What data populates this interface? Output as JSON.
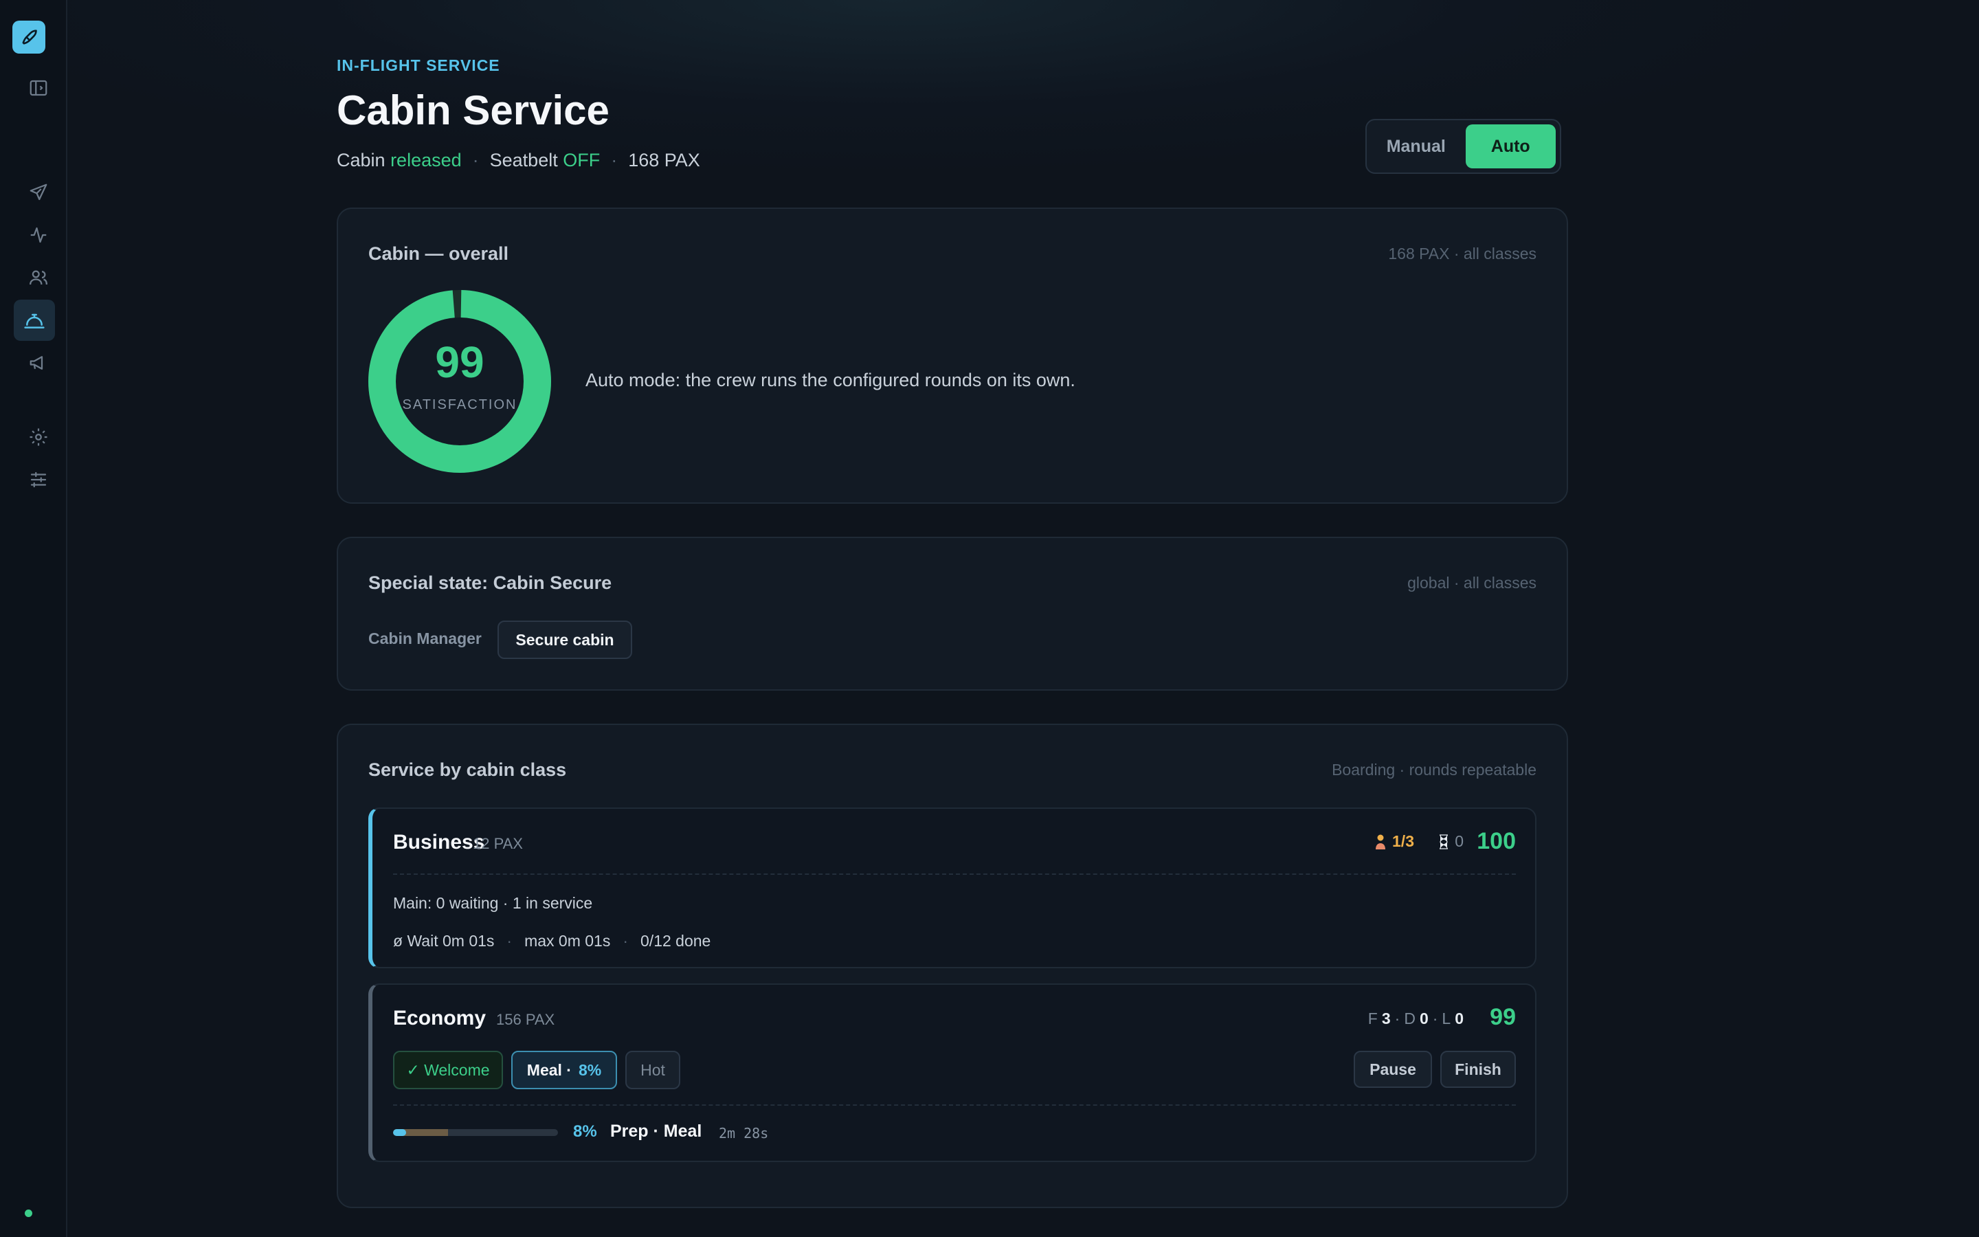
{
  "header": {
    "eyebrow": "IN-FLIGHT SERVICE",
    "title": "Cabin Service",
    "status": {
      "cabin_prefix": "Cabin",
      "cabin_state": "released",
      "seatbelt_prefix": "Seatbelt",
      "seatbelt_state": "OFF",
      "pax": "168 PAX"
    },
    "mode": {
      "manual_label": "Manual",
      "auto_label": "Auto",
      "selected": "Auto"
    }
  },
  "overall": {
    "title": "Cabin — overall",
    "meta": "168 PAX · all classes",
    "satisfaction": "99",
    "satisfaction_value": 99,
    "satisfaction_label": "SATISFACTION",
    "message": "Auto mode: the crew runs the configured rounds on its own."
  },
  "special": {
    "title": "Special state: Cabin Secure",
    "meta": "global · all classes",
    "role_label": "Cabin Manager",
    "button_label": "Secure cabin"
  },
  "service": {
    "title": "Service by cabin class",
    "meta": "Boarding · rounds repeatable",
    "business": {
      "name": "Business",
      "pax": "12 PAX",
      "crew": "1/3",
      "queue": "0",
      "score": "100",
      "main_line": "Main: 0 waiting · 1 in service",
      "wait": "ø Wait 0m 01s",
      "max": "max 0m 01s",
      "done": "0/12 done"
    },
    "economy": {
      "name": "Economy",
      "pax": "156 PAX",
      "f_label": "F",
      "f_val": "3",
      "d_label": "D",
      "d_val": "0",
      "l_label": "L",
      "l_val": "0",
      "score": "99",
      "rounds": {
        "welcome": "✓ Welcome",
        "meal": "Meal ·",
        "meal_pct": "8%",
        "hot": "Hot"
      },
      "pause_label": "Pause",
      "finish_label": "Finish",
      "progress_value": 0.08,
      "progress_pct": "8%",
      "progress_phase": "Prep · Meal",
      "progress_time": "2m 28s"
    }
  },
  "colors": {
    "accent": "#57c3ea",
    "success": "#3ccf8a",
    "warning": "#f0b04a",
    "background": "#0e141c"
  }
}
